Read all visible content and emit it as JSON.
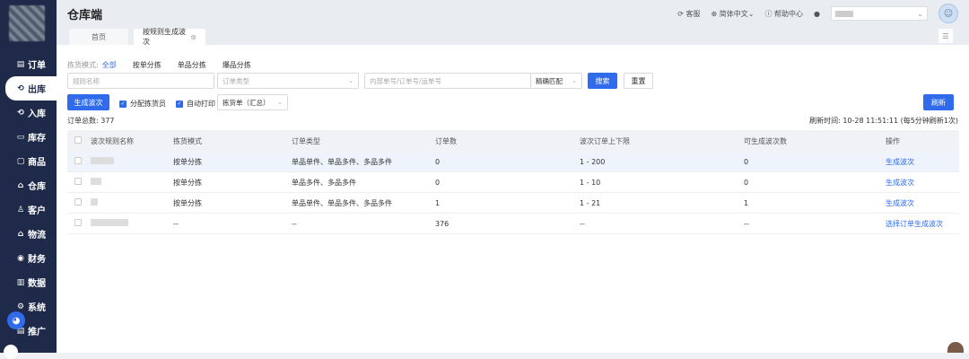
{
  "app": {
    "title": "仓库端"
  },
  "sidebar": {
    "items": [
      {
        "label": "订单",
        "icon": "order-icon",
        "glyph": "▤"
      },
      {
        "label": "出库",
        "icon": "outbound-icon",
        "glyph": "⟲"
      },
      {
        "label": "入库",
        "icon": "inbound-icon",
        "glyph": "⟲"
      },
      {
        "label": "库存",
        "icon": "stock-icon",
        "glyph": "▭"
      },
      {
        "label": "商品",
        "icon": "goods-icon",
        "glyph": "▢"
      },
      {
        "label": "仓库",
        "icon": "warehouse-icon",
        "glyph": "⌂"
      },
      {
        "label": "客户",
        "icon": "customer-icon",
        "glyph": "♙"
      },
      {
        "label": "物流",
        "icon": "logistics-icon",
        "glyph": "⌂"
      },
      {
        "label": "财务",
        "icon": "finance-icon",
        "glyph": "◉"
      },
      {
        "label": "数据",
        "icon": "data-icon",
        "glyph": "▥"
      },
      {
        "label": "系统",
        "icon": "system-icon",
        "glyph": "⚙"
      },
      {
        "label": "推广",
        "icon": "promo-icon",
        "glyph": "▤"
      }
    ]
  },
  "topbar": {
    "service": "客服",
    "language": "简体中文",
    "help": "帮助中心"
  },
  "tabs": [
    {
      "label": "首页"
    },
    {
      "label": "按规则生成波次"
    }
  ],
  "filters": {
    "mode_label": "拣货模式:",
    "modes": [
      "全部",
      "按单分拣",
      "单品分拣",
      "爆品分拣"
    ],
    "rule_name_placeholder": "规则名称",
    "order_type_placeholder": "订单类型",
    "search_placeholder": "内部单号/订单号/运单号",
    "match_mode": "精确匹配",
    "search_btn": "搜索",
    "reset_btn": "重置"
  },
  "actions": {
    "generate_btn": "生成波次",
    "assign_picker": "分配拣货员",
    "auto_print": "自动打印",
    "print_option": "拣货单（汇总）",
    "refresh_btn": "刷新"
  },
  "summary": {
    "total": "订单总数: 377",
    "refresh_time": "刷新时间:  10-28 11:51:11   (每5分钟刷新1次)"
  },
  "table": {
    "headers": [
      "波次规则名称",
      "拣货模式",
      "订单类型",
      "订单数",
      "波次订单上下限",
      "可生成波次数",
      "操作"
    ],
    "rows": [
      {
        "mode": "按单分拣",
        "type": "单品单件、单品多件、多品多件",
        "count": "0",
        "limit": "1 - 200",
        "gen": "0",
        "action": "生成波次"
      },
      {
        "mode": "按单分拣",
        "type": "单品多件、多品多件",
        "count": "0",
        "limit": "1 - 10",
        "gen": "0",
        "action": "生成波次"
      },
      {
        "mode": "按单分拣",
        "type": "单品单件、单品多件、多品多件",
        "count": "1",
        "limit": "1 - 21",
        "gen": "1",
        "action": "生成波次"
      },
      {
        "mode": "--",
        "type": "--",
        "count": "376",
        "limit": "--",
        "gen": "--",
        "action": "选择订单生成波次"
      }
    ]
  }
}
